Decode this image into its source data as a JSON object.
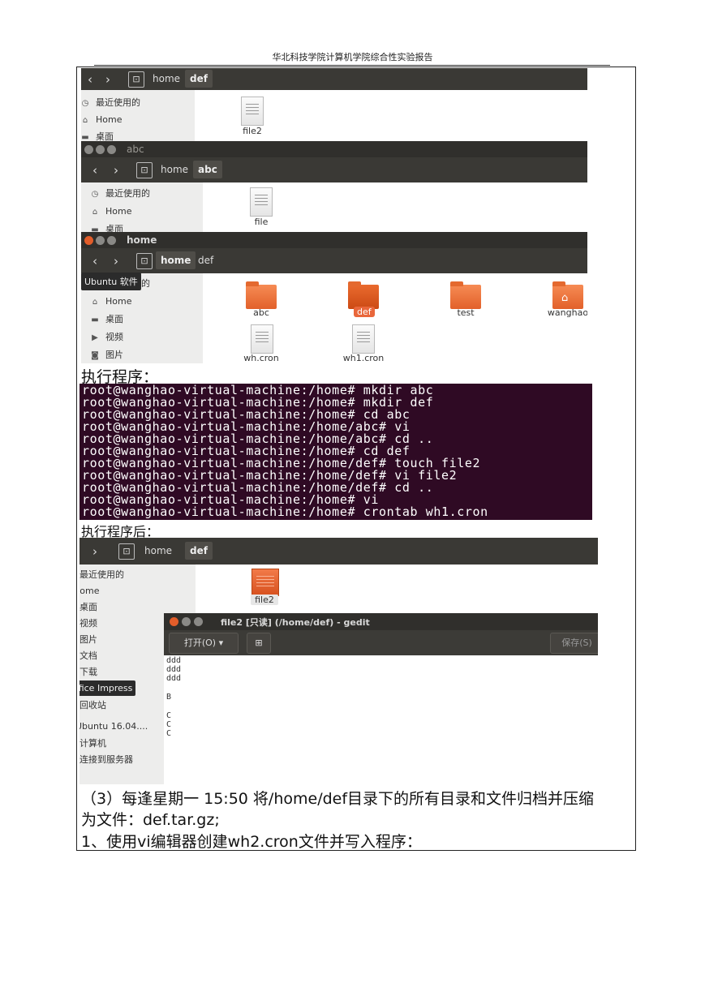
{
  "header": {
    "title": "华北科技学院计算机学院综合性实验报告"
  },
  "window_def_top": {
    "crumbs": [
      "home",
      "def"
    ],
    "sidebar": [
      "最近使用的",
      "Home",
      "桌面"
    ],
    "files": [
      {
        "name": "file2"
      }
    ]
  },
  "window_abc": {
    "title": "abc",
    "crumbs": [
      "home",
      "abc"
    ],
    "sidebar": [
      "最近使用的",
      "Home",
      "桌面"
    ],
    "files": [
      {
        "name": "file"
      }
    ]
  },
  "window_home": {
    "title": "home",
    "crumbs": [
      "home",
      "def"
    ],
    "tooltip": "Ubuntu 软件",
    "sidebar": [
      "的",
      "Home",
      "桌面",
      "视频",
      "图片"
    ],
    "items": [
      "abc",
      "def",
      "test",
      "wanghao",
      "wh.cron",
      "wh1.cron"
    ]
  },
  "section1_label": "执行程序：",
  "terminal_lines": [
    "root@wanghao-virtual-machine:/home# mkdir abc",
    "root@wanghao-virtual-machine:/home# mkdir def",
    "root@wanghao-virtual-machine:/home# cd abc",
    "root@wanghao-virtual-machine:/home/abc# vi",
    "root@wanghao-virtual-machine:/home/abc# cd ..",
    "root@wanghao-virtual-machine:/home# cd def",
    "root@wanghao-virtual-machine:/home/def# touch file2",
    "root@wanghao-virtual-machine:/home/def# vi file2",
    "root@wanghao-virtual-machine:/home/def# cd ..",
    "root@wanghao-virtual-machine:/home# vi",
    "root@wanghao-virtual-machine:/home# crontab wh1.cron"
  ],
  "section2_label": "执行程序后：",
  "window_after": {
    "crumbs": [
      "home",
      "def"
    ],
    "sidebar": [
      "最近使用的",
      "Home",
      "桌面",
      "视频",
      "图片",
      "文档",
      "下载",
      "ffice Impress",
      "回收站",
      "Ubuntu 16.04....",
      "计算机",
      "连接到服务器"
    ],
    "files": [
      {
        "name": "file2"
      }
    ]
  },
  "gedit": {
    "title": "file2 [只读] (/home/def) - gedit",
    "open_label": "打开(O)",
    "save_label": "保存(S)",
    "lines": [
      "ddd",
      "ddd",
      "ddd",
      "",
      "B",
      "",
      "C",
      "C",
      "C"
    ]
  },
  "paragraph": {
    "line1": "（3）每逢星期一 15:50 将/home/def目录下的所有目录和文件归档并压缩",
    "line2": "为文件：def.tar.gz;",
    "line3": "1、使用vi编辑器创建wh2.cron文件并写入程序："
  }
}
